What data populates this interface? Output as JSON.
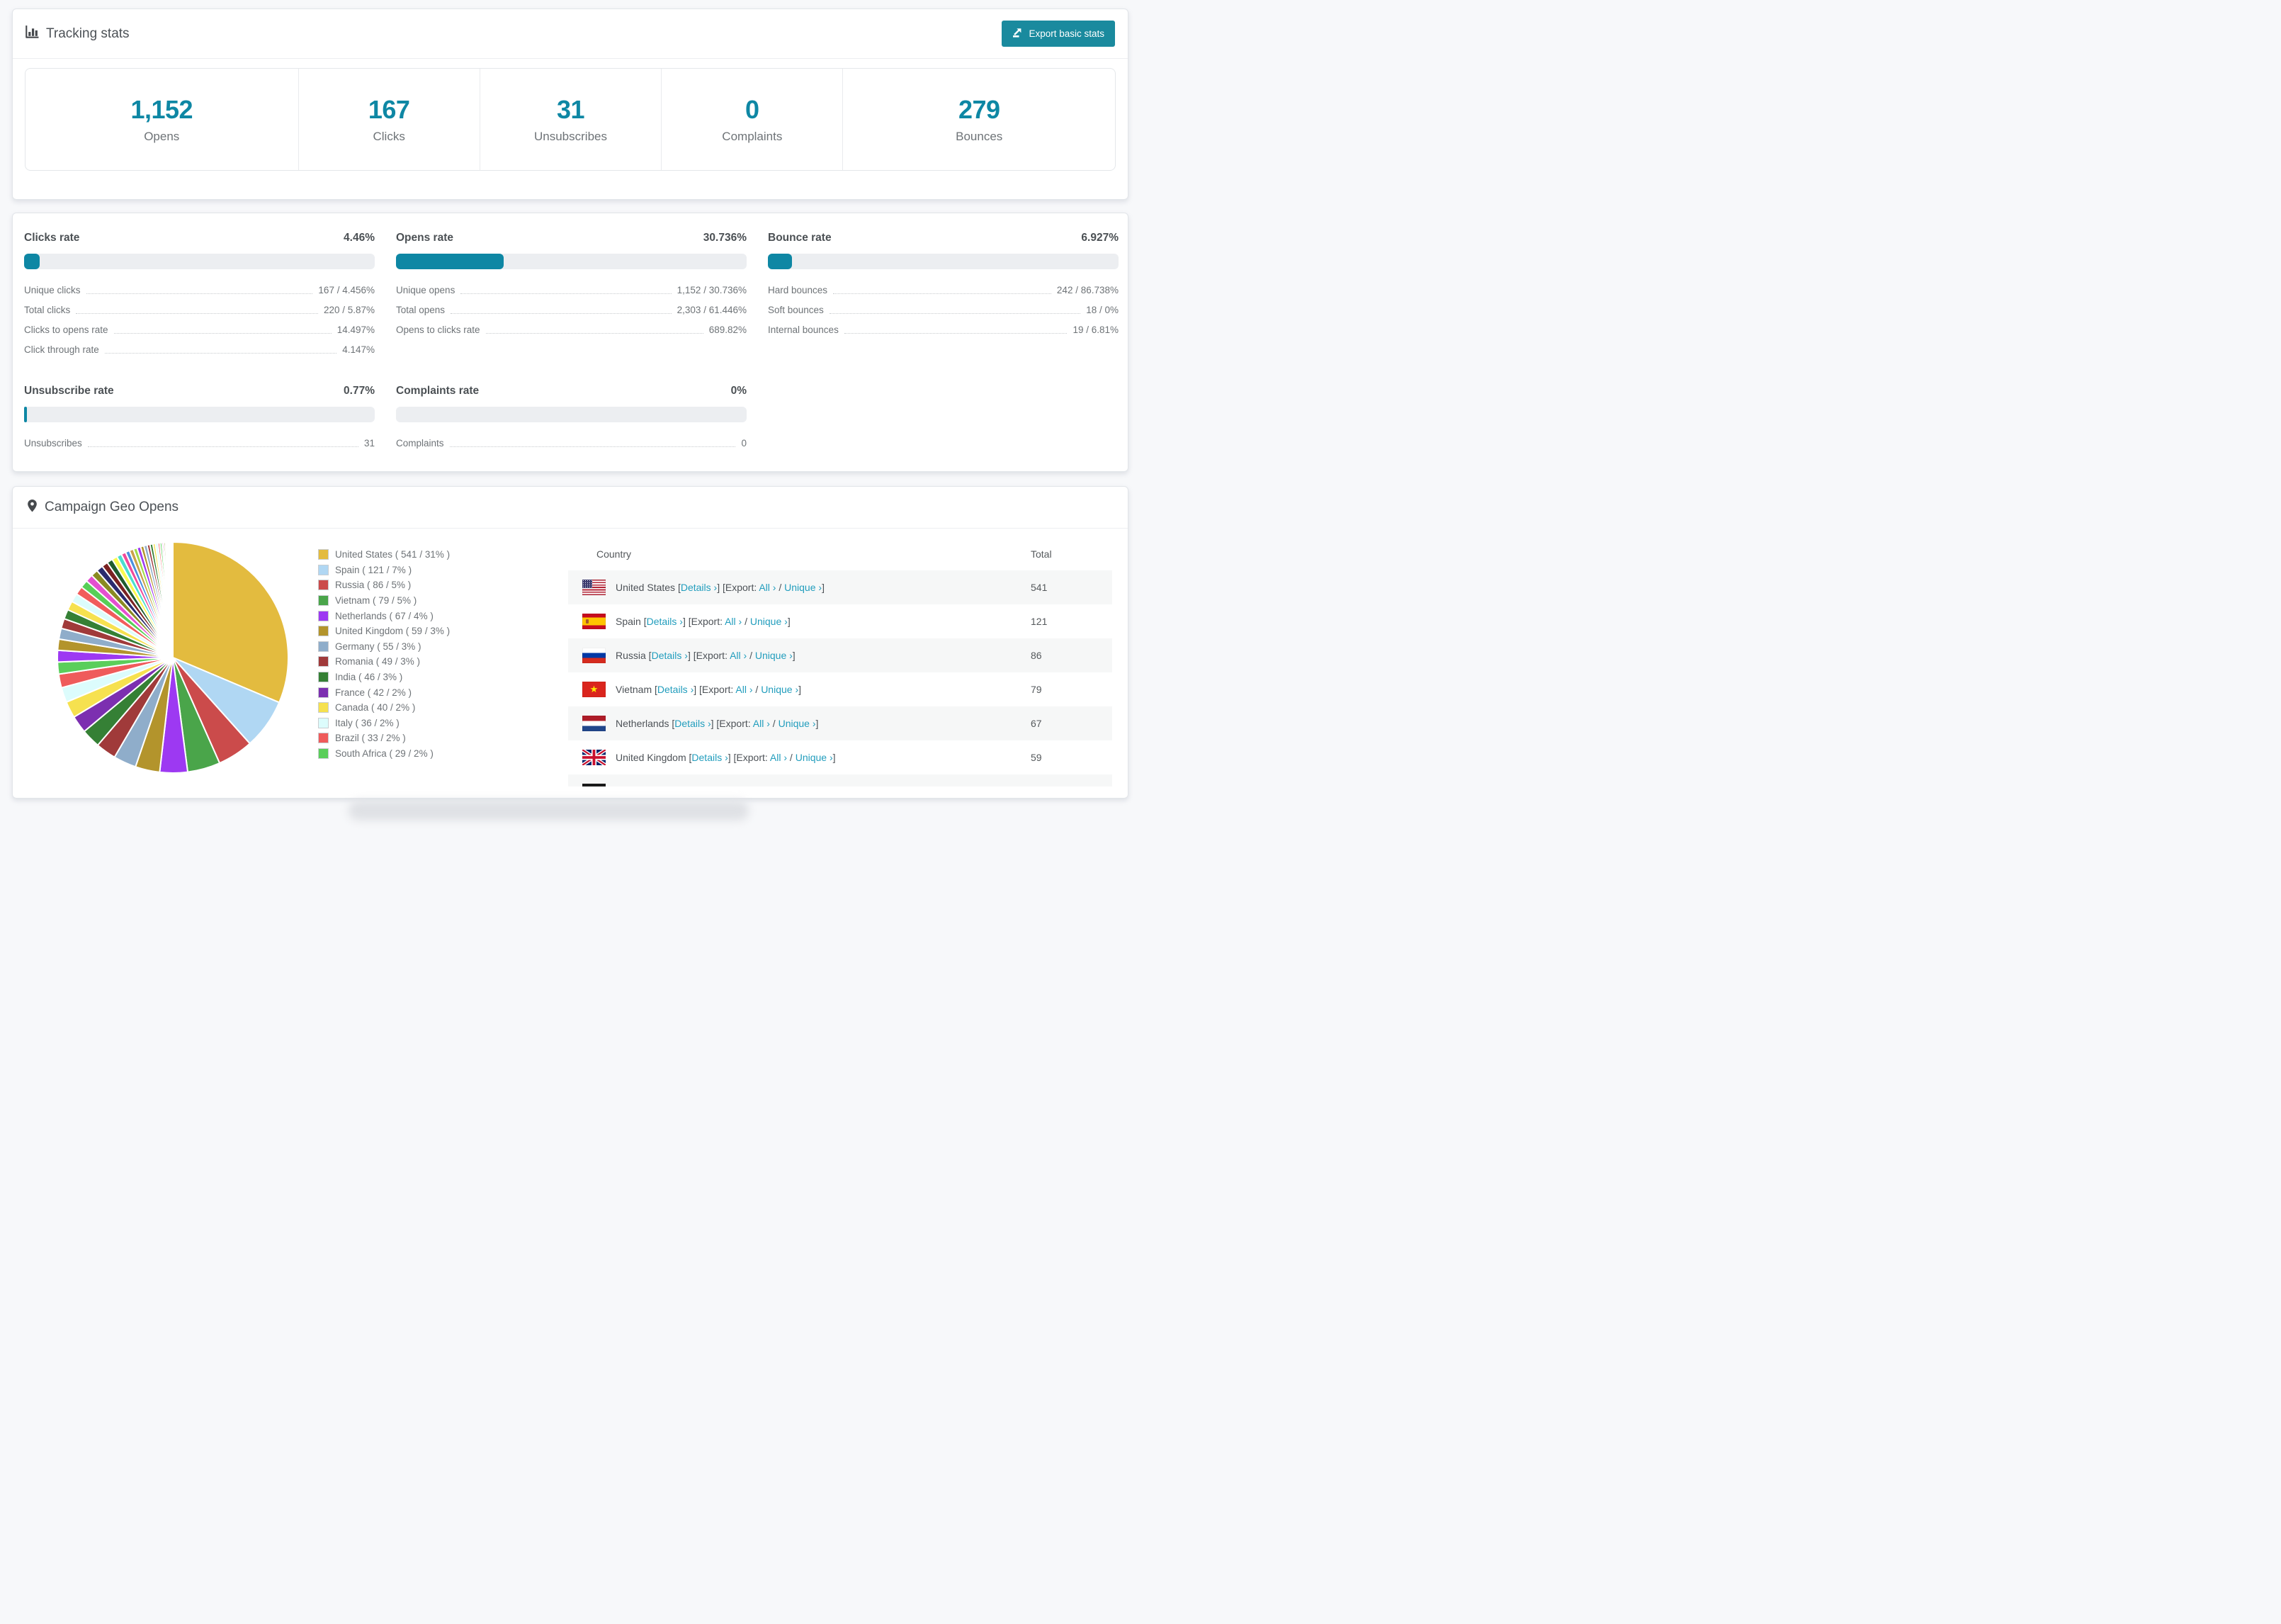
{
  "colors": {
    "accent": "#0e87a4",
    "link": "#219dbd",
    "button": "#1a8a9e",
    "progress_track": "#eceef1",
    "table_stripe": "#f6f7f7"
  },
  "header": {
    "title": "Tracking stats",
    "export_label": "Export basic stats"
  },
  "stats": [
    {
      "value": "1,152",
      "label": "Opens"
    },
    {
      "value": "167",
      "label": "Clicks"
    },
    {
      "value": "31",
      "label": "Unsubscribes"
    },
    {
      "value": "0",
      "label": "Complaints"
    },
    {
      "value": "279",
      "label": "Bounces"
    }
  ],
  "rates": [
    {
      "title": "Clicks rate",
      "display": "4.46%",
      "percent": 4.46,
      "rows": [
        [
          "Unique clicks",
          "167 / 4.456%"
        ],
        [
          "Total clicks",
          "220 / 5.87%"
        ],
        [
          "Clicks to opens rate",
          "14.497%"
        ],
        [
          "Click through rate",
          "4.147%"
        ]
      ]
    },
    {
      "title": "Opens rate",
      "display": "30.736%",
      "percent": 30.736,
      "rows": [
        [
          "Unique opens",
          "1,152 / 30.736%"
        ],
        [
          "Total opens",
          "2,303 / 61.446%"
        ],
        [
          "Opens to clicks rate",
          "689.82%"
        ]
      ]
    },
    {
      "title": "Bounce rate",
      "display": "6.927%",
      "percent": 6.927,
      "rows": [
        [
          "Hard bounces",
          "242 / 86.738%"
        ],
        [
          "Soft bounces",
          "18 / 0%"
        ],
        [
          "Internal bounces",
          "19 / 6.81%"
        ]
      ]
    },
    {
      "title": "Unsubscribe rate",
      "display": "0.77%",
      "percent": 0.77,
      "rows": [
        [
          "Unsubscribes",
          "31"
        ]
      ]
    },
    {
      "title": "Complaints rate",
      "display": "0%",
      "percent": 0,
      "rows": [
        [
          "Complaints",
          "0"
        ]
      ]
    }
  ],
  "geo": {
    "title": "Campaign Geo Opens",
    "table": {
      "headers": [
        "Country",
        "Total"
      ],
      "link_labels": {
        "details": "Details",
        "export_prefix": "Export:",
        "all": "All",
        "unique": "Unique"
      },
      "rows": [
        {
          "country": "United States",
          "flag": "us",
          "total": "541"
        },
        {
          "country": "Spain",
          "flag": "es",
          "total": "121"
        },
        {
          "country": "Russia",
          "flag": "ru",
          "total": "86"
        },
        {
          "country": "Vietnam",
          "flag": "vn",
          "total": "79"
        },
        {
          "country": "Netherlands",
          "flag": "nl",
          "total": "67"
        },
        {
          "country": "United Kingdom",
          "flag": "gb",
          "total": "59"
        }
      ],
      "partial_row": {
        "flag_top_color": "#1a1a1a"
      }
    }
  },
  "chart_data": {
    "type": "pie",
    "title": "Campaign Geo Opens",
    "start_angle_deg": -90,
    "direction": "clockwise",
    "legend_position": "right-of-chart",
    "legend_format": "LABEL ( VALUE / PCT% )",
    "series": [
      {
        "label": "United States",
        "value": 541,
        "pct": "31",
        "color": "#e3bb3f"
      },
      {
        "label": "Spain",
        "value": 121,
        "pct": "7",
        "color": "#b0d7f3"
      },
      {
        "label": "Russia",
        "value": 86,
        "pct": "5",
        "color": "#cb4b4b"
      },
      {
        "label": "Vietnam",
        "value": 79,
        "pct": "5",
        "color": "#4aa54a"
      },
      {
        "label": "Netherlands",
        "value": 67,
        "pct": "4",
        "color": "#9d39f2"
      },
      {
        "label": "United Kingdom",
        "value": 59,
        "pct": "3",
        "color": "#b3942c"
      },
      {
        "label": "Germany",
        "value": 55,
        "pct": "3",
        "color": "#8fadca"
      },
      {
        "label": "Romania",
        "value": 49,
        "pct": "3",
        "color": "#a03a3a"
      },
      {
        "label": "India",
        "value": 46,
        "pct": "3",
        "color": "#358035"
      },
      {
        "label": "France",
        "value": 42,
        "pct": "2",
        "color": "#7c2fb0"
      },
      {
        "label": "Canada",
        "value": 40,
        "pct": "2",
        "color": "#f6e14f"
      },
      {
        "label": "Italy",
        "value": 36,
        "pct": "2",
        "color": "#dcfcfc"
      },
      {
        "label": "Brazil",
        "value": 33,
        "pct": "2",
        "color": "#ef5b5b"
      },
      {
        "label": "South Africa",
        "value": 29,
        "pct": "2",
        "color": "#5ace5a"
      }
    ],
    "others_unlabeled": {
      "values": [
        28,
        27,
        26,
        24,
        23,
        22,
        21,
        20,
        19,
        18,
        17,
        16,
        15,
        14,
        13,
        12,
        11,
        10,
        10,
        9,
        9,
        8,
        8,
        7,
        7,
        6,
        6,
        5,
        5,
        4,
        4,
        3,
        3,
        3,
        2,
        2,
        2,
        1,
        1,
        1
      ],
      "colors": [
        "#9d39f2",
        "#b3942c",
        "#8fadca",
        "#a03a3a",
        "#358035",
        "#f6e14f",
        "#dcfcfc",
        "#f15c5c",
        "#57cf57",
        "#e44fd0",
        "#8a8a22",
        "#2b2b6e",
        "#7a2222",
        "#1f5c2f",
        "#fafa4e",
        "#4adfcf",
        "#f04a9a",
        "#4a90e0",
        "#caa24a",
        "#9fdc4a"
      ]
    }
  }
}
